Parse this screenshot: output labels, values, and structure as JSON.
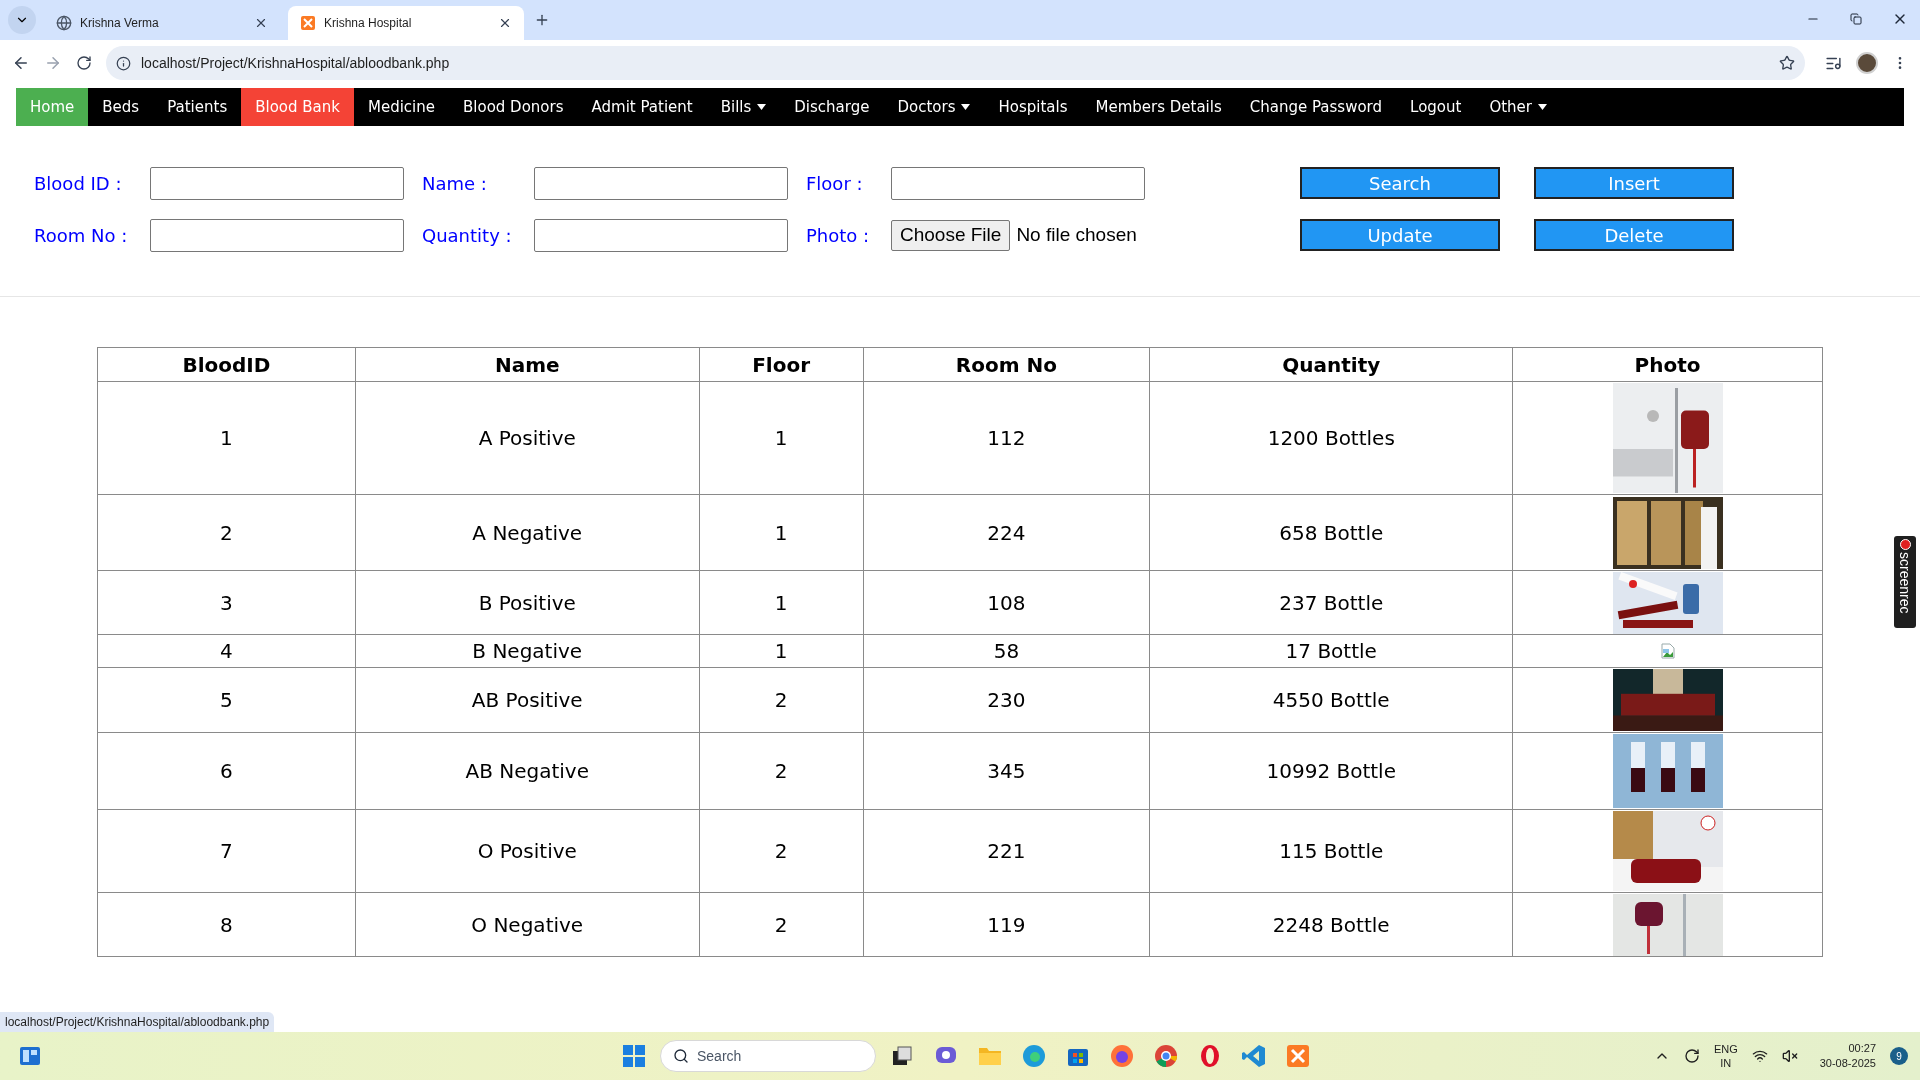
{
  "browser": {
    "tabs": [
      {
        "title": "Krishna Verma",
        "selected": false,
        "kind": "globe"
      },
      {
        "title": "Krishna Hospital",
        "selected": true,
        "kind": "xampp"
      }
    ],
    "address": "localhost/Project/KrishnaHospital/abloodbank.php",
    "status_url": "localhost/Project/KrishnaHospital/abloodbank.php"
  },
  "nav": {
    "items": [
      {
        "label": "Home",
        "color": "#4caf50",
        "dropdown": false
      },
      {
        "label": "Beds",
        "dropdown": false
      },
      {
        "label": "Patients",
        "dropdown": false
      },
      {
        "label": "Blood Bank",
        "color": "#f44336",
        "dropdown": false
      },
      {
        "label": "Medicine",
        "dropdown": false
      },
      {
        "label": "Blood Donors",
        "dropdown": false
      },
      {
        "label": "Admit Patient",
        "dropdown": false
      },
      {
        "label": "Bills",
        "dropdown": true
      },
      {
        "label": "Discharge",
        "dropdown": false
      },
      {
        "label": "Doctors",
        "dropdown": true
      },
      {
        "label": "Hospitals",
        "dropdown": false
      },
      {
        "label": "Members Details",
        "dropdown": false
      },
      {
        "label": "Change Password",
        "dropdown": false
      },
      {
        "label": "Logout",
        "dropdown": false
      },
      {
        "label": "Other",
        "dropdown": true
      }
    ]
  },
  "form": {
    "rows": [
      {
        "fields": [
          {
            "label": "Blood ID :",
            "kind": "text"
          },
          {
            "label": "Name :",
            "kind": "text"
          },
          {
            "label": "Floor :",
            "kind": "text"
          }
        ],
        "buttons": [
          "Search",
          "Insert"
        ]
      },
      {
        "fields": [
          {
            "label": "Room No :",
            "kind": "text"
          },
          {
            "label": "Quantity :",
            "kind": "text"
          },
          {
            "label": "Photo :",
            "kind": "file",
            "button": "Choose File",
            "status": "No file chosen"
          }
        ],
        "buttons": [
          "Update",
          "Delete"
        ]
      }
    ]
  },
  "table": {
    "columns": [
      "BloodID",
      "Name",
      "Floor",
      "Room No",
      "Quantity",
      "Photo"
    ],
    "rows": [
      {
        "cells": [
          "1",
          "A Positive",
          "1",
          "112",
          "1200 Bottles"
        ],
        "photo": {
          "kind": "picture"
        }
      },
      {
        "cells": [
          "2",
          "A Negative",
          "1",
          "224",
          "658 Bottle"
        ],
        "photo": {
          "kind": "picture"
        }
      },
      {
        "cells": [
          "3",
          "B Positive",
          "1",
          "108",
          "237 Bottle"
        ],
        "photo": {
          "kind": "picture"
        }
      },
      {
        "cells": [
          "4",
          "B Negative",
          "1",
          "58",
          "17 Bottle"
        ],
        "photo": {
          "kind": "broken"
        }
      },
      {
        "cells": [
          "5",
          "AB Positive",
          "2",
          "230",
          "4550 Bottle"
        ],
        "photo": {
          "kind": "picture"
        }
      },
      {
        "cells": [
          "6",
          "AB Negative",
          "2",
          "345",
          "10992 Bottle"
        ],
        "photo": {
          "kind": "picture"
        }
      },
      {
        "cells": [
          "7",
          "O Positive",
          "2",
          "221",
          "115 Bottle"
        ],
        "photo": {
          "kind": "picture"
        }
      },
      {
        "cells": [
          "8",
          "O Negative",
          "2",
          "119",
          "2248 Bottle"
        ],
        "photo": {
          "kind": "picture"
        }
      }
    ]
  },
  "side_widget": {
    "label": "screenrec"
  },
  "taskbar": {
    "search_placeholder": "Search",
    "language": [
      "ENG",
      "IN"
    ],
    "time": "00:27",
    "date": "30-08-2025",
    "notifications": "9"
  }
}
